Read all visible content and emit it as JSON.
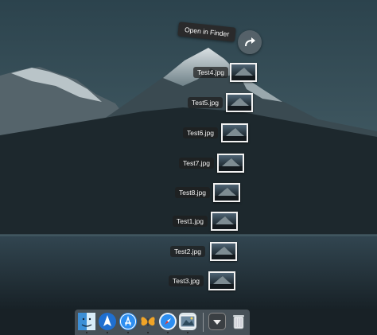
{
  "context_menu": {
    "open_in_finder_label": "Open in Finder"
  },
  "stack": {
    "items": [
      {
        "name": "Test4.jpg"
      },
      {
        "name": "Test5.jpg"
      },
      {
        "name": "Test6.jpg"
      },
      {
        "name": "Test7.jpg"
      },
      {
        "name": "Test8.jpg"
      },
      {
        "name": "Test1.jpg"
      },
      {
        "name": "Test2.jpg"
      },
      {
        "name": "Test3.jpg"
      }
    ]
  },
  "dock": {
    "apps": [
      {
        "icon": "finder-icon",
        "running": true
      },
      {
        "icon": "launchpad-icon",
        "running": true
      },
      {
        "icon": "app-store-icon",
        "running": true
      },
      {
        "icon": "tes-butterfly-icon",
        "running": true
      },
      {
        "icon": "safari-icon",
        "running": true
      },
      {
        "icon": "preview-icon",
        "running": true
      }
    ],
    "stack_icon": "downloads-stack-icon",
    "trash_icon": "trash-icon"
  },
  "colors": {
    "sky_top": "#2f4651",
    "sky_bottom": "#4f6b74",
    "mountain_dark": "#1a2429",
    "water": "#1f2d34"
  }
}
